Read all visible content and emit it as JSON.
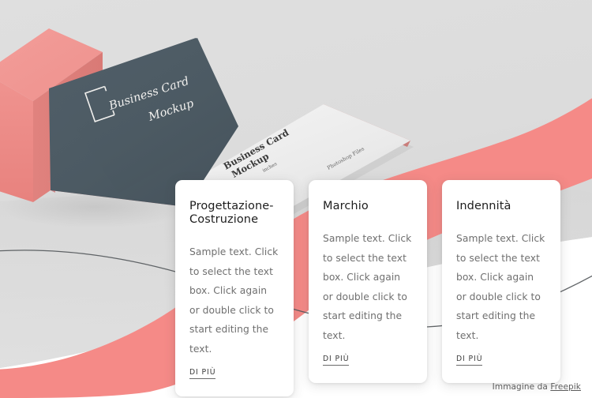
{
  "page": {
    "background_color": "#ffffff",
    "hero_background_color": "#dcdcdc",
    "accent_color": "#f58a87",
    "dark_card_color": "#4d5a63",
    "line_color": "#55595c"
  },
  "hero": {
    "name": "business-card-mockup-photo",
    "dark_business_card": {
      "title_line1": "Business Card",
      "title_line2": "Mockup",
      "logo": "square-bracket-logo",
      "color": "#4d5a63",
      "edge_color": "#d98d8a"
    },
    "light_business_card": {
      "title_line1": "Business Card",
      "title_line2": "Mockup",
      "unit_label": "inches",
      "side_label": "Photoshop Files",
      "color": "#efefef",
      "edge_color": "#c98b88"
    },
    "cube": {
      "name": "pink-cube",
      "top_color": "#f0928e",
      "front_color": "#ee8b87",
      "side_color": "#e2817d"
    },
    "waves": {
      "color": "#f58a87",
      "line_color": "#55595c"
    }
  },
  "cards": [
    {
      "id": "progettazione-costruzione",
      "title": "Progettazione-Costruzione",
      "body": "Sample text. Click to select the text box. Click again or double click to start editing the text.",
      "link_label": "DI PIÙ"
    },
    {
      "id": "marchio",
      "title": "Marchio",
      "body": "Sample text. Click to select the text box. Click again or double click to start editing the text.",
      "link_label": "DI PIÙ"
    },
    {
      "id": "indennita",
      "title": "Indennità",
      "body": "Sample text. Click to select the text box. Click again or double click to start editing the text.",
      "link_label": "DI PIÙ"
    }
  ],
  "attribution": {
    "prefix": "Immagine da ",
    "link_label": "Freepik"
  }
}
